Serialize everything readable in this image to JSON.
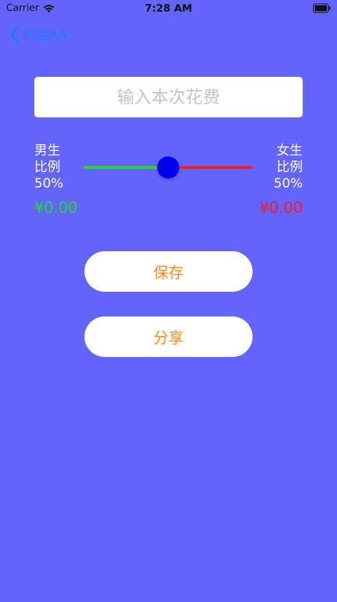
{
  "status_bar": {
    "carrier": "Carrier",
    "time": "7:28 AM"
  },
  "nav": {
    "back_label": "约会AA"
  },
  "amount_input": {
    "placeholder": "输入本次花费",
    "value": ""
  },
  "male": {
    "title": "男生",
    "ratio_label": "比例",
    "percent": "50%",
    "amount": "¥0.00",
    "color": "#22dd22"
  },
  "female": {
    "title": "女生",
    "ratio_label": "比例",
    "percent": "50%",
    "amount": "¥0.00",
    "color": "#ff1a1a"
  },
  "slider": {
    "value": 0.5,
    "left_color": "#22dd22",
    "right_color": "#ff1a1a",
    "thumb_color": "#0000ee"
  },
  "buttons": {
    "save_label": "保存",
    "share_label": "分享"
  },
  "colors": {
    "background": "#6464ff",
    "accent": "#ff8a1a",
    "link": "#1a7cff"
  }
}
